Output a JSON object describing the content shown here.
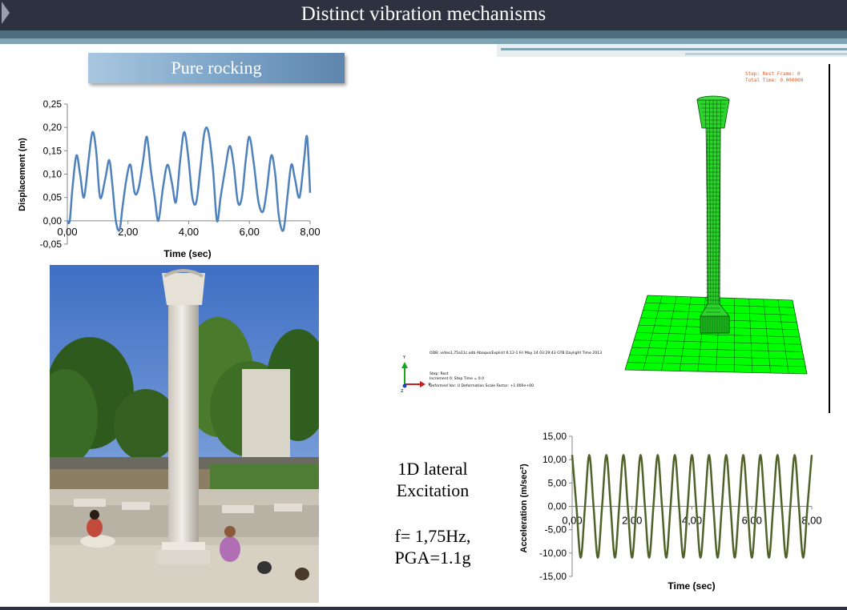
{
  "slide": {
    "title": "Distinct vibration mechanisms",
    "section_label": "Pure rocking",
    "excitation_label_line1": "1D lateral",
    "excitation_label_line2": "Excitation",
    "freq_text": "f= 1,75Hz,",
    "pga_text": "PGA=1.1g"
  },
  "colors": {
    "header_bg": "#2e3240",
    "band_dark": "#4e6d7d",
    "band_light": "#7ea4b4",
    "displacement_line": "#4f81bd",
    "acceleration_line": "#4f6228",
    "fem_green": "#00ff00"
  },
  "fem": {
    "header_line1": "Step: Rest      Frame: 0",
    "header_line2": "Total Time: 0.000000",
    "info_line": "ODB: video1,75a11c.odb    Abaqus/Explicit 6.12-1    Fri May 14 03:29:43 GTB Daylight Time 2013",
    "step_line1": "Step: Rest",
    "step_line2": "Increment    0: Step Time =  0.0",
    "step_line3": "Deformed Var: U   Deformation Scale Factor: +1.000e+00",
    "axis_y": "Y",
    "axis_x": "X",
    "axis_z": "Z"
  },
  "chart_data": [
    {
      "type": "line",
      "ylabel": "Displacement (m)",
      "xlabel": "Time (sec)",
      "xlim": [
        0,
        8
      ],
      "ylim": [
        -0.05,
        0.25
      ],
      "x_ticks": [
        "0,00",
        "2,00",
        "4,00",
        "6,00",
        "8,00"
      ],
      "y_ticks": [
        "-0,05",
        "0,00",
        "0,05",
        "0,10",
        "0,15",
        "0,20",
        "0,25"
      ],
      "grid": false,
      "series": [
        {
          "x": [
            0.0,
            0.08,
            0.17,
            0.3,
            0.42,
            0.55,
            0.7,
            0.83,
            0.95,
            1.08,
            1.25,
            1.38,
            1.48,
            1.6,
            1.72,
            1.82,
            1.95,
            2.08,
            2.22,
            2.35,
            2.5,
            2.62,
            2.75,
            2.88,
            3.0,
            3.15,
            3.3,
            3.45,
            3.58,
            3.72,
            3.85,
            3.98,
            4.12,
            4.25,
            4.38,
            4.52,
            4.65,
            4.8,
            4.93,
            5.05,
            5.2,
            5.35,
            5.48,
            5.62,
            5.75,
            5.88,
            6.0,
            6.15,
            6.3,
            6.45,
            6.58,
            6.72,
            6.85,
            6.97,
            7.12,
            7.25,
            7.38,
            7.5,
            7.65,
            7.8,
            7.9,
            8.0
          ],
          "y": [
            0.0,
            0.0,
            0.07,
            0.14,
            0.1,
            0.05,
            0.13,
            0.19,
            0.15,
            0.05,
            0.09,
            0.13,
            0.08,
            0.0,
            -0.02,
            0.03,
            0.09,
            0.12,
            0.06,
            0.07,
            0.13,
            0.18,
            0.11,
            0.05,
            0.0,
            0.07,
            0.12,
            0.08,
            0.04,
            0.13,
            0.19,
            0.14,
            0.05,
            0.04,
            0.11,
            0.19,
            0.19,
            0.11,
            0.0,
            0.05,
            0.11,
            0.16,
            0.12,
            0.04,
            0.05,
            0.13,
            0.18,
            0.12,
            0.04,
            0.02,
            0.07,
            0.14,
            0.1,
            0.01,
            -0.02,
            0.05,
            0.12,
            0.09,
            0.05,
            0.13,
            0.18,
            0.06
          ]
        }
      ]
    },
    {
      "type": "line",
      "ylabel": "Acceleration (m/sec²)",
      "xlabel": "Time (sec)",
      "xlim": [
        0,
        8
      ],
      "ylim": [
        -15,
        15
      ],
      "x_ticks": [
        "0,00",
        "2,00",
        "4,00",
        "6,00",
        "8,00"
      ],
      "y_ticks": [
        "-15,00",
        "-10,00",
        "-5,00",
        "0,00",
        "5,00",
        "10,00",
        "15,00"
      ],
      "grid": false,
      "frequency_hz": 1.75,
      "amplitude": 11,
      "series": [
        {
          "x": [
            0.0,
            0.143,
            0.286,
            0.429,
            0.571,
            0.714,
            0.857,
            1.0,
            1.143,
            1.286,
            1.429,
            1.571,
            1.714,
            1.857,
            2.0,
            2.143,
            2.286,
            2.429,
            2.571,
            2.714,
            2.857,
            3.0,
            3.143,
            3.286,
            3.429,
            3.571,
            3.714,
            3.857,
            4.0,
            4.143,
            4.286,
            4.429,
            4.571,
            4.714,
            4.857,
            5.0,
            5.143,
            5.286,
            5.429,
            5.571,
            5.714,
            5.857,
            6.0,
            6.143,
            6.286,
            6.429,
            6.571,
            6.714,
            6.857,
            7.0,
            7.143,
            7.286,
            7.429,
            7.571,
            7.714,
            7.857,
            8.0
          ],
          "y": [
            11,
            0,
            -11,
            0,
            11,
            0,
            -11,
            0,
            11,
            0,
            -11,
            0,
            11,
            0,
            -11,
            0,
            11,
            0,
            -11,
            0,
            11,
            0,
            -11,
            0,
            11,
            0,
            -11,
            0,
            11,
            0,
            -11,
            0,
            11,
            0,
            -11,
            0,
            11,
            0,
            -11,
            0,
            11,
            0,
            -11,
            0,
            11,
            0,
            -11,
            0,
            11,
            0,
            -11,
            0,
            11,
            0,
            -11,
            0,
            11
          ]
        }
      ]
    }
  ]
}
